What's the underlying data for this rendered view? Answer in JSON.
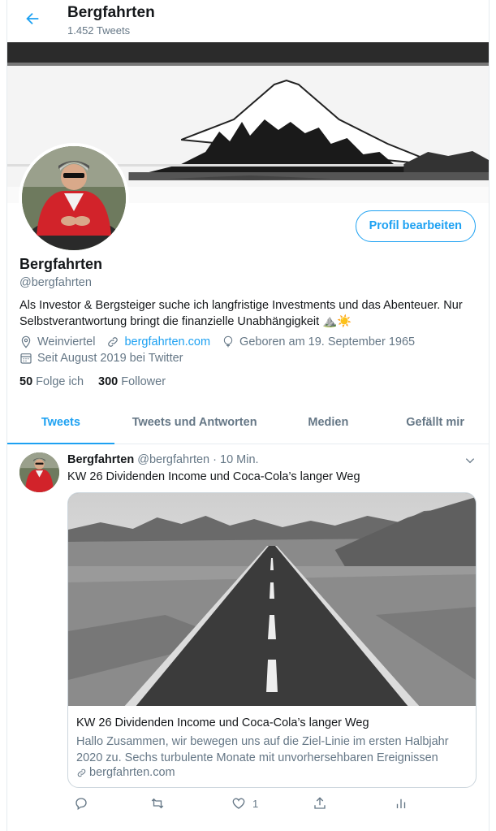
{
  "header": {
    "title": "Bergfahrten",
    "tweet_count": "1.452 Tweets",
    "back_icon": "arrow-left-icon"
  },
  "profile": {
    "edit_button": "Profil bearbeiten",
    "name": "Bergfahrten",
    "handle": "@bergfahrten",
    "bio": "Als Investor & Bergsteiger suche ich langfristige Investments und das Abenteuer. Nur Selbstverantwortung bringt die finanzielle Unabhängigkeit",
    "bio_emoji": "⛰️☀️",
    "location": "Weinviertel",
    "website": "bergfahrten.com",
    "birthday": "Geboren am 19. September 1965",
    "joined": "Seit August 2019 bei Twitter",
    "following_count": "50",
    "following_label": "Folge ich",
    "followers_count": "300",
    "followers_label": "Follower"
  },
  "tabs": [
    {
      "label": "Tweets",
      "active": true
    },
    {
      "label": "Tweets und Antworten",
      "active": false
    },
    {
      "label": "Medien",
      "active": false
    },
    {
      "label": "Gefällt mir",
      "active": false
    }
  ],
  "tweet": {
    "name": "Bergfahrten",
    "handle": "@bergfahrten",
    "separator": "·",
    "time": "10 Min.",
    "text": "KW 26 Dividenden Income und Coca-Cola’s langer Weg",
    "card": {
      "title": "KW 26 Dividenden Income und Coca-Cola’s langer Weg",
      "description": "Hallo Zusammen, wir bewegen uns auf die Ziel-Linie im ersten Halbjahr 2020 zu. Sechs turbulente Monate mit unvorhersehbaren Ereignissen",
      "domain": "bergfahrten.com"
    },
    "actions": {
      "reply_count": "",
      "retweet_count": "",
      "like_count": "1"
    }
  },
  "colors": {
    "accent": "#1da1f2",
    "secondary_text": "#657786",
    "primary_text": "#14171a",
    "border": "#e6ecf0"
  }
}
